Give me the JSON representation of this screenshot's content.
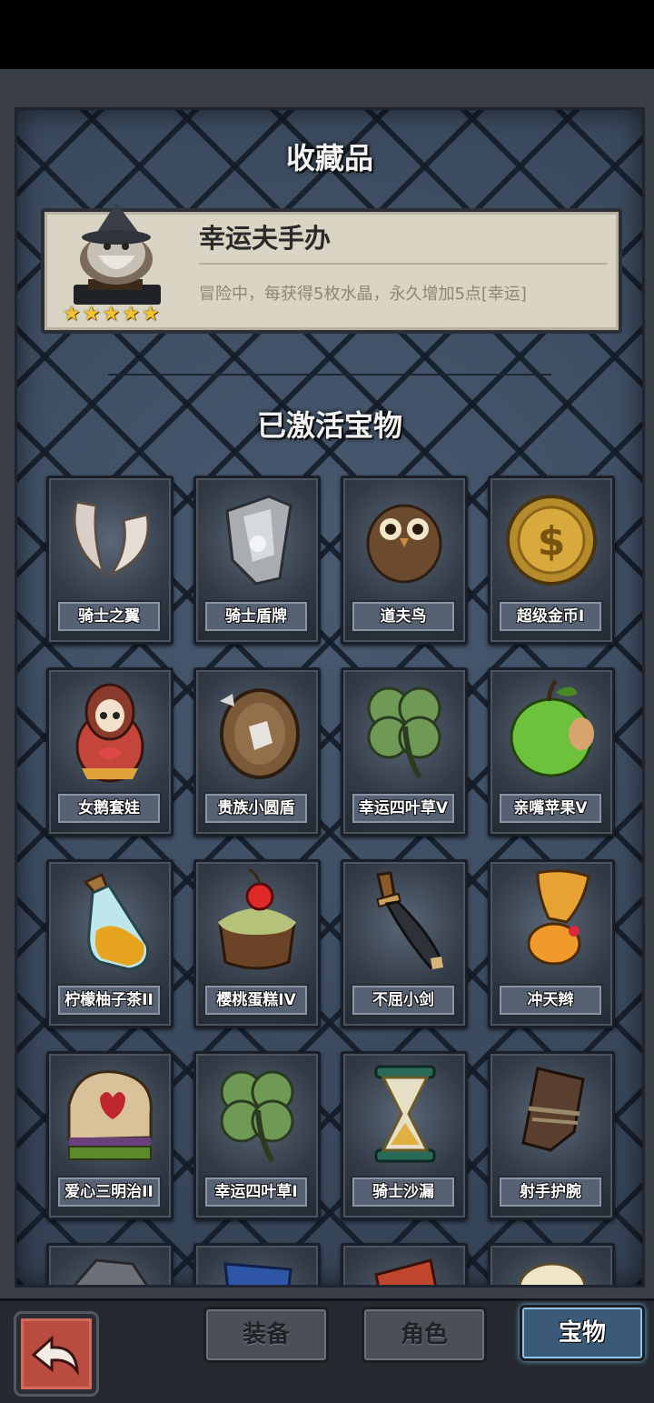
{
  "collection": {
    "heading": "收藏品",
    "name": "幸运夫手办",
    "description": "冒险中，每获得5枚水晶，永久增加5点[幸运]",
    "stars": 5
  },
  "activated": {
    "heading": "已激活宝物",
    "items": [
      {
        "label": "骑士之翼",
        "icon": "wings-icon"
      },
      {
        "label": "骑士盾牌",
        "icon": "shield-icon"
      },
      {
        "label": "道夫鸟",
        "icon": "owl-icon"
      },
      {
        "label": "超级金币I",
        "icon": "gold-coin-icon"
      },
      {
        "label": "女鹅套娃",
        "icon": "matryoshka-icon"
      },
      {
        "label": "贵族小圆盾",
        "icon": "round-shield-icon"
      },
      {
        "label": "幸运四叶草V",
        "icon": "clover-icon"
      },
      {
        "label": "亲嘴苹果V",
        "icon": "apple-icon"
      },
      {
        "label": "柠檬柚子茶II",
        "icon": "potion-bottle-icon"
      },
      {
        "label": "樱桃蛋糕IV",
        "icon": "cherry-cake-icon"
      },
      {
        "label": "不屈小剑",
        "icon": "sword-icon"
      },
      {
        "label": "冲天辫",
        "icon": "ponytail-icon"
      },
      {
        "label": "爱心三明治II",
        "icon": "sandwich-icon"
      },
      {
        "label": "幸运四叶草I",
        "icon": "clover-icon"
      },
      {
        "label": "骑士沙漏",
        "icon": "hourglass-icon"
      },
      {
        "label": "射手护腕",
        "icon": "bracer-icon"
      }
    ]
  },
  "bottom_nav": {
    "back_icon": "back-arrow-icon",
    "tabs": [
      {
        "label": "装备"
      },
      {
        "label": "角色"
      },
      {
        "label": "宝物"
      }
    ],
    "active_tab": "宝物"
  }
}
